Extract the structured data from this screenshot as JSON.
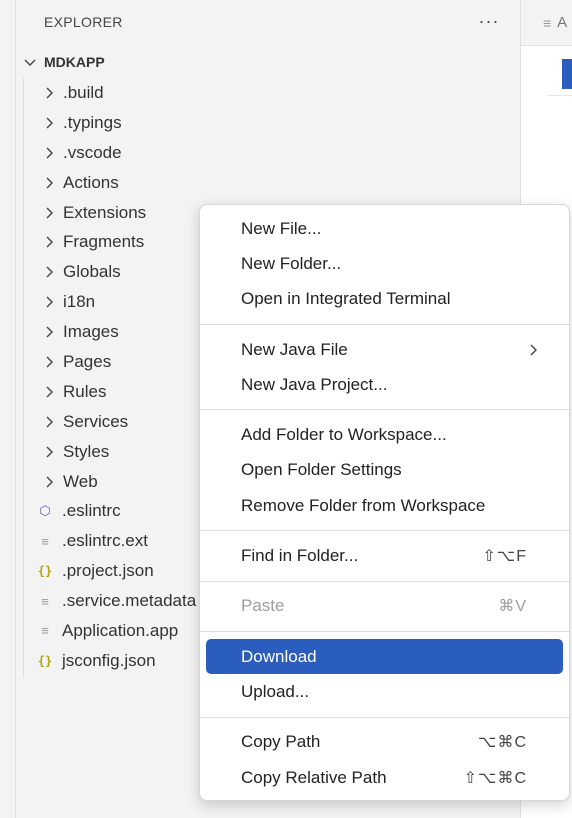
{
  "explorer": {
    "title": "EXPLORER",
    "more_label": "···",
    "root": "MDKAPP"
  },
  "tree": {
    "folders": [
      ".build",
      ".typings",
      ".vscode",
      "Actions",
      "Extensions",
      "Fragments",
      "Globals",
      "i18n",
      "Images",
      "Pages",
      "Rules",
      "Services",
      "Styles",
      "Web"
    ],
    "files": [
      {
        "name": ".eslintrc",
        "icon": "eslint-icon",
        "glyph": "⬡",
        "color": "#6c5bb8"
      },
      {
        "name": ".eslintrc.ext",
        "icon": "lines-file-icon",
        "glyph": "≡",
        "color": "#9a9a9a"
      },
      {
        "name": ".project.json",
        "icon": "json-file-icon",
        "glyph": "{}",
        "color": "#b6a20c"
      },
      {
        "name": ".service.metadata",
        "icon": "lines-file-icon",
        "glyph": "≡",
        "color": "#9a9a9a"
      },
      {
        "name": "Application.app",
        "icon": "lines-file-icon",
        "glyph": "≡",
        "color": "#9a9a9a"
      },
      {
        "name": "jsconfig.json",
        "icon": "json-file-icon",
        "glyph": "{}",
        "color": "#b6a20c"
      }
    ]
  },
  "editor": {
    "tab_label": "A"
  },
  "context_menu": {
    "groups": [
      [
        {
          "label": "New File...",
          "shortcut": ""
        },
        {
          "label": "New Folder...",
          "shortcut": ""
        },
        {
          "label": "Open in Integrated Terminal",
          "shortcut": ""
        }
      ],
      [
        {
          "label": "New Java File",
          "shortcut": "",
          "submenu": true
        },
        {
          "label": "New Java Project...",
          "shortcut": ""
        }
      ],
      [
        {
          "label": "Add Folder to Workspace...",
          "shortcut": ""
        },
        {
          "label": "Open Folder Settings",
          "shortcut": ""
        },
        {
          "label": "Remove Folder from Workspace",
          "shortcut": ""
        }
      ],
      [
        {
          "label": "Find in Folder...",
          "shortcut": "⇧⌥F"
        }
      ],
      [
        {
          "label": "Paste",
          "shortcut": "⌘V",
          "disabled": true
        }
      ],
      [
        {
          "label": "Download",
          "shortcut": "",
          "active": true
        },
        {
          "label": "Upload...",
          "shortcut": ""
        }
      ],
      [
        {
          "label": "Copy Path",
          "shortcut": "⌥⌘C"
        },
        {
          "label": "Copy Relative Path",
          "shortcut": "⇧⌥⌘C"
        }
      ]
    ]
  },
  "colors": {
    "accent": "#2a5dbd",
    "sidebar_bg": "#f3f3f3",
    "menu_bg": "#ffffff"
  }
}
